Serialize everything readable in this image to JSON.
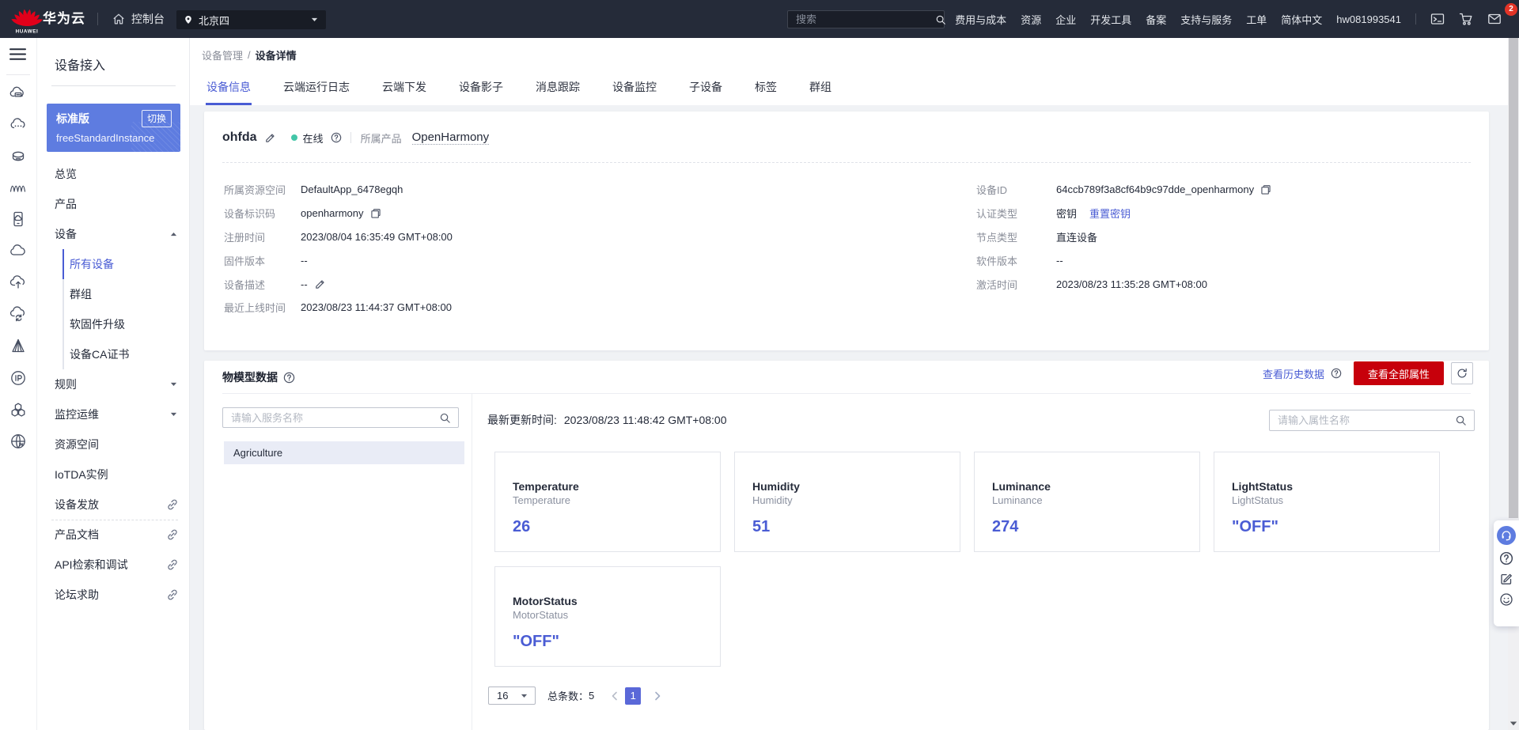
{
  "colors": {
    "accent": "#4a5cd4",
    "brand_red": "#c7000b",
    "instance_blue": "#5e7ce0",
    "success_green": "#43c6a8",
    "topbar_bg": "#252b39"
  },
  "topbar": {
    "logo_text": "HUAWEI",
    "brand": "华为云",
    "console": "控制台",
    "region": "北京四",
    "search_placeholder": "搜索",
    "menu": [
      {
        "label": "费用与成本"
      },
      {
        "label": "资源"
      },
      {
        "label": "企业"
      },
      {
        "label": "开发工具"
      },
      {
        "label": "备案"
      },
      {
        "label": "支持与服务"
      },
      {
        "label": "工单"
      },
      {
        "label": "简体中文"
      }
    ],
    "username": "hw081993541",
    "badge_count": "2"
  },
  "rail": {
    "icons": [
      {
        "name": "cloud-server-icon"
      },
      {
        "name": "cloud-dots-icon"
      },
      {
        "name": "cloud-storage-icon"
      },
      {
        "name": "waveform-icon"
      },
      {
        "name": "device-cloud-icon"
      },
      {
        "name": "cloud-icon"
      },
      {
        "name": "cloud-upload-icon"
      },
      {
        "name": "cloud-sync-icon"
      },
      {
        "name": "prism-icon"
      },
      {
        "name": "ip-circle-icon"
      },
      {
        "name": "cluster-icon"
      },
      {
        "name": "globe-icon"
      }
    ]
  },
  "sidebar": {
    "title": "设备接入",
    "instance": {
      "edition": "标准版",
      "switch_label": "切换",
      "name": "freeStandardInstance"
    },
    "menu": [
      {
        "label": "总览"
      },
      {
        "label": "产品"
      },
      {
        "label": "设备",
        "caret": "caret-up-icon"
      },
      {
        "label": "所有设备",
        "sub": true,
        "active": true
      },
      {
        "label": "群组",
        "sub": true
      },
      {
        "label": "软固件升级",
        "sub": true
      },
      {
        "label": "设备CA证书",
        "sub": true
      },
      {
        "label": "规则",
        "caret": "caret-down-icon"
      },
      {
        "label": "监控运维",
        "caret": "caret-down-icon"
      },
      {
        "label": "资源空间"
      },
      {
        "label": "IoTDA实例"
      },
      {
        "label": "设备发放",
        "external": true
      },
      {
        "label": "产品文档",
        "external": true,
        "divider_before": true
      },
      {
        "label": "API检索和调试",
        "external": true
      },
      {
        "label": "论坛求助",
        "external": true
      }
    ]
  },
  "breadcrumb": {
    "parent": "设备管理",
    "separator": "/",
    "current": "设备详情"
  },
  "tabs": [
    {
      "label": "设备信息",
      "active": true
    },
    {
      "label": "云端运行日志"
    },
    {
      "label": "云端下发"
    },
    {
      "label": "设备影子"
    },
    {
      "label": "消息跟踪"
    },
    {
      "label": "设备监控"
    },
    {
      "label": "子设备"
    },
    {
      "label": "标签"
    },
    {
      "label": "群组"
    }
  ],
  "device": {
    "name": "ohfda",
    "status": "在线",
    "product_label": "所属产品",
    "product": "OpenHarmony",
    "info_left": [
      {
        "label": "所属资源空间",
        "value": "DefaultApp_6478egqh"
      },
      {
        "label": "设备标识码",
        "value": "openharmony",
        "copy": true
      },
      {
        "label": "注册时间",
        "value": "2023/08/04 16:35:49 GMT+08:00"
      },
      {
        "label": "固件版本",
        "value": "--"
      },
      {
        "label": "设备描述",
        "value": "--",
        "edit": true
      },
      {
        "label": "最近上线时间",
        "value": "2023/08/23 11:44:37 GMT+08:00"
      }
    ],
    "info_right": [
      {
        "label": "设备ID",
        "value": "64ccb789f3a8cf64b9c97dde_openharmony",
        "copy": true
      },
      {
        "label": "认证类型",
        "value": "密钥",
        "link": "重置密钥"
      },
      {
        "label": "节点类型",
        "value": "直连设备"
      },
      {
        "label": "软件版本",
        "value": "--"
      },
      {
        "label": "激活时间",
        "value": "2023/08/23 11:35:28 GMT+08:00"
      }
    ]
  },
  "model": {
    "title": "物模型数据",
    "history_link": "查看历史数据",
    "view_all_button": "查看全部属性",
    "service_search_placeholder": "请输入服务名称",
    "services": [
      {
        "name": "Agriculture",
        "active": true
      }
    ],
    "updated_label": "最新更新时间:",
    "updated_value": "2023/08/23 11:48:42 GMT+08:00",
    "property_search_placeholder": "请输入属性名称",
    "properties": [
      {
        "name": "Temperature",
        "desc": "Temperature",
        "value": "26"
      },
      {
        "name": "Humidity",
        "desc": "Humidity",
        "value": "51"
      },
      {
        "name": "Luminance",
        "desc": "Luminance",
        "value": "274"
      },
      {
        "name": "LightStatus",
        "desc": "LightStatus",
        "value": "\"OFF\""
      },
      {
        "name": "MotorStatus",
        "desc": "MotorStatus",
        "value": "\"OFF\""
      }
    ],
    "pagination": {
      "page_size": "16",
      "total_label": "总条数：",
      "total": "5",
      "current_page": "1"
    }
  },
  "float_toolbar": {
    "icons": [
      {
        "name": "headset-icon",
        "primary": true
      },
      {
        "name": "help-circle-icon"
      },
      {
        "name": "form-icon"
      },
      {
        "name": "smiley-icon"
      }
    ]
  }
}
